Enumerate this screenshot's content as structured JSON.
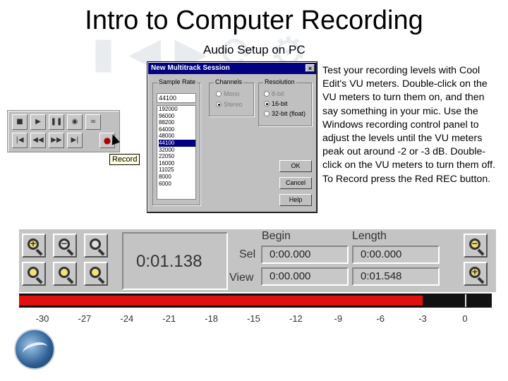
{
  "slide": {
    "title": "Intro to Computer Recording",
    "subtitle": "Audio Setup on PC",
    "description": "Test your recording levels with Cool Edit's VU meters. Double-click on the VU meters to turn them on, and then say something in your mic. Use the Windows recording control panel to adjust the levels until the VU meters peak out around -2 or -3 dB. Double-click on the VU meters to turn them off. To Record press the Red REC button."
  },
  "transport": {
    "record_tooltip": "Record",
    "icons": [
      "stop-icon",
      "play-icon",
      "pause-icon",
      "play-looped-icon",
      "loop-icon",
      "go-to-start-icon",
      "rewind-icon",
      "fast-forward-icon",
      "go-to-end-icon",
      "record-icon"
    ]
  },
  "dialog": {
    "title": "New Multitrack Session",
    "close_glyph": "×",
    "sample_rate": {
      "label": "Sample Rate",
      "value": "44100",
      "options": [
        "192000",
        "96000",
        "88200",
        "64000",
        "48000",
        "44100",
        "32000",
        "22050",
        "16000",
        "11025",
        "8000",
        "6000"
      ],
      "selected": "44100"
    },
    "channels": {
      "label": "Channels",
      "options": [
        {
          "label": "Mono",
          "checked": false
        },
        {
          "label": "Stereo",
          "checked": true
        }
      ]
    },
    "resolution": {
      "label": "Resolution",
      "options": [
        {
          "label": "8-bit",
          "checked": false
        },
        {
          "label": "16-bit",
          "checked": true
        },
        {
          "label": "32-bit (float)",
          "checked": false
        }
      ]
    },
    "buttons": {
      "ok": "OK",
      "cancel": "Cancel",
      "help": "Help"
    }
  },
  "toolbar": {
    "time_display": "0:01.138",
    "begin_header": "Begin",
    "length_header": "Length",
    "sel_label": "Sel",
    "view_label": "View",
    "sel_begin": "0:00.000",
    "sel_length": "0:00.000",
    "view_begin": "0:00.000",
    "view_length": "0:01.548",
    "zoom_icons": [
      "zoom-in-icon",
      "zoom-out-icon",
      "zoom-full-icon",
      "zoom-selection-icon",
      "zoom-to-left-icon",
      "zoom-to-right-icon",
      "zoom-out-vertical-icon",
      "zoom-in-vertical-icon"
    ]
  },
  "meter": {
    "level_db": -3,
    "ticks": [
      "-30",
      "-27",
      "-24",
      "-21",
      "-18",
      "-15",
      "-12",
      "-9",
      "-6",
      "-3",
      "0"
    ],
    "colors": {
      "level": "#e01010",
      "background": "#111111"
    }
  }
}
